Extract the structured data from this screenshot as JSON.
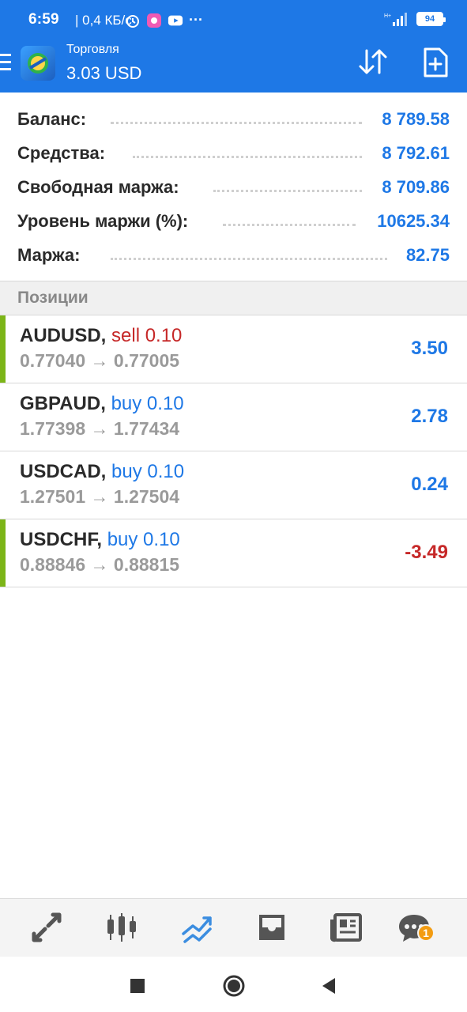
{
  "status_bar": {
    "time": "6:59",
    "network_speed": "| 0,4 КБ/с",
    "network_type": "H+",
    "battery": "94"
  },
  "app_bar": {
    "title": "Торговля",
    "subtitle": "3.03 USD"
  },
  "account": [
    {
      "label": "Баланс:",
      "value": "8 789.58"
    },
    {
      "label": "Средства:",
      "value": "8 792.61"
    },
    {
      "label": "Свободная маржа:",
      "value": "8 709.86"
    },
    {
      "label": "Уровень маржи (%):",
      "value": "10625.34"
    },
    {
      "label": "Маржа:",
      "value": "82.75"
    }
  ],
  "positions_header": "Позиции",
  "positions": [
    {
      "symbol": "AUDUSD,",
      "direction": "sell 0.10",
      "open": "0.77040",
      "arrow": "→",
      "current": "0.77005",
      "profit": "3.50"
    },
    {
      "symbol": "GBPAUD,",
      "direction": "buy 0.10",
      "open": "1.77398",
      "arrow": "→",
      "current": "1.77434",
      "profit": "2.78"
    },
    {
      "symbol": "USDCAD,",
      "direction": "buy 0.10",
      "open": "1.27501",
      "arrow": "→",
      "current": "1.27504",
      "profit": "0.24"
    },
    {
      "symbol": "USDCHF,",
      "direction": "buy 0.10",
      "open": "0.88846",
      "arrow": "→",
      "current": "0.88815",
      "profit": "-3.49"
    }
  ],
  "tabbar": {
    "tabs": [
      "quotes-icon",
      "chart-icon",
      "trade-icon",
      "history-icon",
      "news-icon",
      "chat-icon"
    ],
    "chat_badge": "1"
  },
  "colors": {
    "accent": "#1e78e6",
    "negative": "#c62828",
    "position_marker": "#7cb518"
  }
}
